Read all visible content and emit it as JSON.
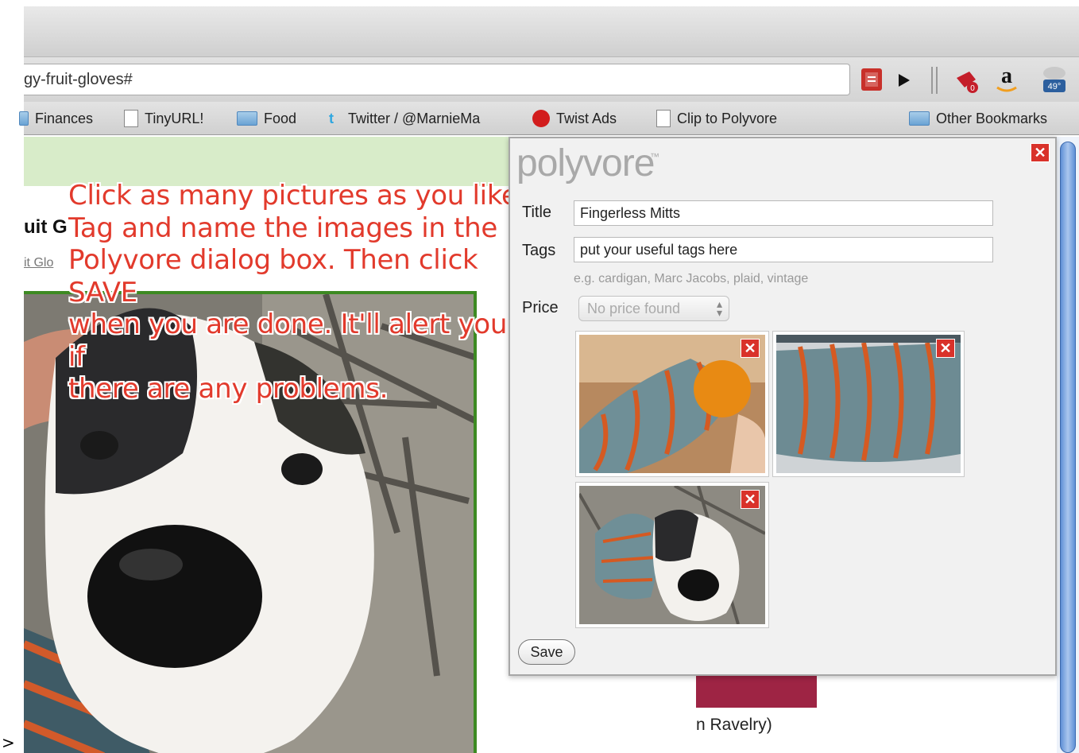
{
  "browser": {
    "url_fragment": "gy-fruit-gloves#",
    "bookmarks": [
      {
        "label": "Finances",
        "icon": "folder-icon"
      },
      {
        "label": "TinyURL!",
        "icon": "page-icon"
      },
      {
        "label": "Food",
        "icon": "folder-icon"
      },
      {
        "label": "Twitter / @MarnieMa",
        "icon": "twitter-icon"
      },
      {
        "label": "Twist Ads",
        "icon": "twist-icon"
      },
      {
        "label": "Clip to Polyvore",
        "icon": "page-icon"
      },
      {
        "label": "Other Bookmarks",
        "icon": "folder-icon"
      }
    ],
    "toolbar_icons": [
      "pdf-icon",
      "play-icon",
      "clip-icon",
      "amazon-icon",
      "weather-icon"
    ],
    "amazon_glyph": "a",
    "weather_temp": "49°"
  },
  "page": {
    "heading_fragment": "uit G",
    "subheading_fragment": "it Glo",
    "footer_fragment": "n Ravelry)",
    "stray_char": ">"
  },
  "annotation": {
    "text": "Click as many pictures as you like\nTag and name the images in the\nPolyvore dialog box. Then click SAVE\nwhen you are done. It'll alert you if\nthere are any problems.",
    "color": "#e23a2c"
  },
  "dialog": {
    "logo": "polyvore",
    "logo_tm": "™",
    "close_glyph": "✕",
    "title_label": "Title",
    "title_value": "Fingerless Mitts",
    "tags_label": "Tags",
    "tags_value": "put your useful tags here",
    "tags_hint": "e.g. cardigan, Marc Jacobs, plaid, vintage",
    "price_label": "Price",
    "price_value": "No price found",
    "save_label": "Save",
    "remove_glyph": "✕"
  }
}
